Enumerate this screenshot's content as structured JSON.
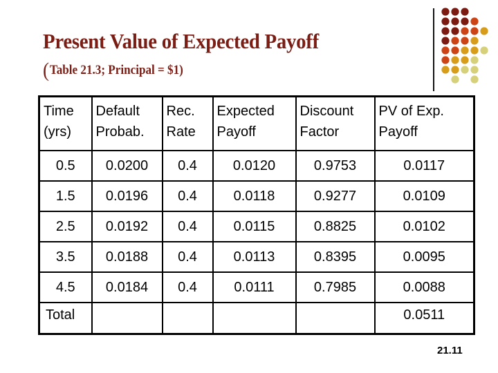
{
  "slide": {
    "title": "Present Value of Expected Payoff",
    "subtitle_paren": "(",
    "subtitle": "Table 21.3; Principal = $1)",
    "page_number": "21.11"
  },
  "decoration": {
    "dot_colors": {
      "D": "#7b1a10",
      "O": "#cc4416",
      "G": "#d79c1a",
      "L": "#d6d07a"
    },
    "dot_pattern": [
      "DDD  ",
      "DDDO ",
      "DDOOG",
      "DOOG ",
      "OOGGL",
      "OGGL ",
      "GGLL ",
      " L L "
    ]
  },
  "table": {
    "headers": [
      [
        "Time",
        "(yrs)"
      ],
      [
        "Default",
        "Probab."
      ],
      [
        "Rec.",
        "Rate"
      ],
      [
        "Expected",
        "Payoff"
      ],
      [
        "Discount",
        "Factor"
      ],
      [
        "PV of Exp.",
        "Payoff"
      ]
    ],
    "rows": [
      [
        "0.5",
        "0.0200",
        "0.4",
        "0.0120",
        "0.9753",
        "0.0117"
      ],
      [
        "1.5",
        "0.0196",
        "0.4",
        "0.0118",
        "0.9277",
        "0.0109"
      ],
      [
        "2.5",
        "0.0192",
        "0.4",
        "0.0115",
        "0.8825",
        "0.0102"
      ],
      [
        "3.5",
        "0.0188",
        "0.4",
        "0.0113",
        "0.8395",
        "0.0095"
      ],
      [
        "4.5",
        "0.0184",
        "0.4",
        "0.0111",
        "0.7985",
        "0.0088"
      ]
    ],
    "total_row": [
      "Total",
      "",
      "",
      "",
      "",
      "0.0511"
    ]
  }
}
